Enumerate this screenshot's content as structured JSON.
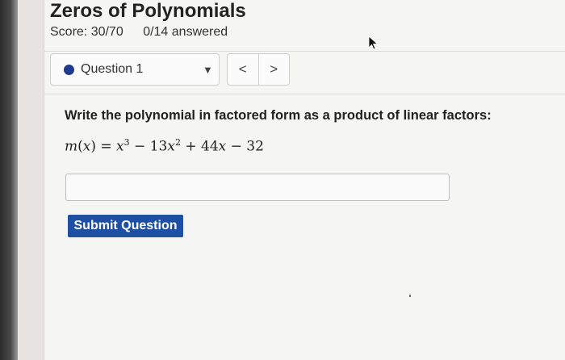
{
  "header": {
    "title": "Zeros of Polynomials",
    "score": "Score: 30/70",
    "answered": "0/14 answered"
  },
  "question_nav": {
    "current_label": "Question 1",
    "prev_label": "<",
    "next_label": ">"
  },
  "question": {
    "prompt": "Write the polynomial in factored form as a product of linear factors:",
    "equation": {
      "lhs_fn": "m",
      "lhs_var": "x",
      "t1_var": "x",
      "t1_exp": "3",
      "t2_coef": "13",
      "t2_var": "x",
      "t2_exp": "2",
      "t3_coef": "44",
      "t3_var": "x",
      "t4_const": "32"
    }
  },
  "answer": {
    "value": ""
  },
  "actions": {
    "submit_label": "Submit Question"
  },
  "colors": {
    "accent": "#1f4fa3",
    "status_dot": "#1f3a8f"
  }
}
